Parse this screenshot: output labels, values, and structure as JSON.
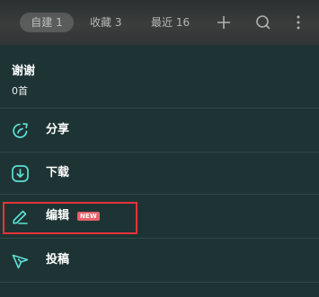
{
  "tabs": [
    {
      "label": "自建 1",
      "active": true
    },
    {
      "label": "收藏 3",
      "active": false
    },
    {
      "label": "最近 16",
      "active": false
    }
  ],
  "toolbar_icons": [
    "plus-icon",
    "search-icon",
    "more-icon"
  ],
  "playlist": {
    "name": "谢谢",
    "count": "0首"
  },
  "menu": {
    "items": [
      {
        "label": "分享",
        "icon": "share-icon"
      },
      {
        "label": "下载",
        "icon": "download-icon"
      },
      {
        "label": "编辑",
        "icon": "edit-icon",
        "badge": "NEW"
      },
      {
        "label": "投稿",
        "icon": "send-icon"
      }
    ]
  },
  "colors": {
    "background": "#1e3434",
    "icon_accent": "#5ee0d6",
    "badge": "#e8626a",
    "highlight": "#e6343c"
  }
}
